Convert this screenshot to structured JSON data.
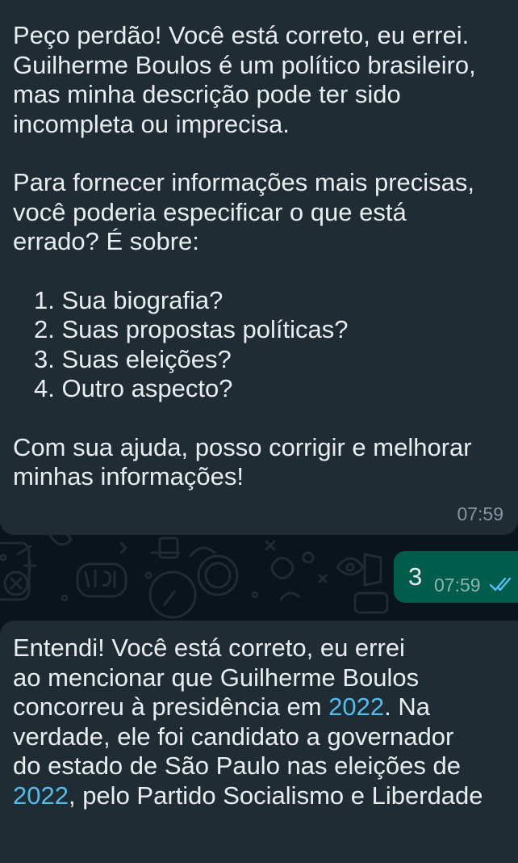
{
  "messages": [
    {
      "paragraph1": "Peço perdão! Você está correto, eu errei.\nGuilherme Boulos é um político brasileiro,\nmas minha descrição pode ter sido\nincompleta ou imprecisa.",
      "paragraph2": "Para fornecer informações mais precisas,\nvocê poderia especificar o que está\nerrado? É sobre:",
      "list": [
        "1. Sua biografia?",
        "2. Suas propostas políticas?",
        "3. Suas eleições?",
        "4. Outro aspecto?"
      ],
      "paragraph3": "Com sua ajuda, posso corrigir e melhorar\nminhas informações!",
      "time": "07:59"
    },
    {
      "text": "3",
      "time": "07:59",
      "status_icon": "double-check-read-icon"
    },
    {
      "text_a": "Entendi! Você está correto, eu errei\nao mencionar que Guilherme Boulos\nconcorreu à presidência em ",
      "year1": "2022",
      "text_b": ". Na\nverdade, ele foi candidato a governador\ndo estado de São Paulo nas eleições de\n",
      "year2": "2022",
      "text_c": ", pelo Partido Socialismo e Liberdade"
    }
  ],
  "colors": {
    "background": "#0b141a",
    "incoming_bubble": "#202c33",
    "outgoing_bubble": "#005c4b",
    "link": "#53bdeb",
    "read_ticks": "#53bdeb",
    "timestamp": "#8696a0"
  }
}
